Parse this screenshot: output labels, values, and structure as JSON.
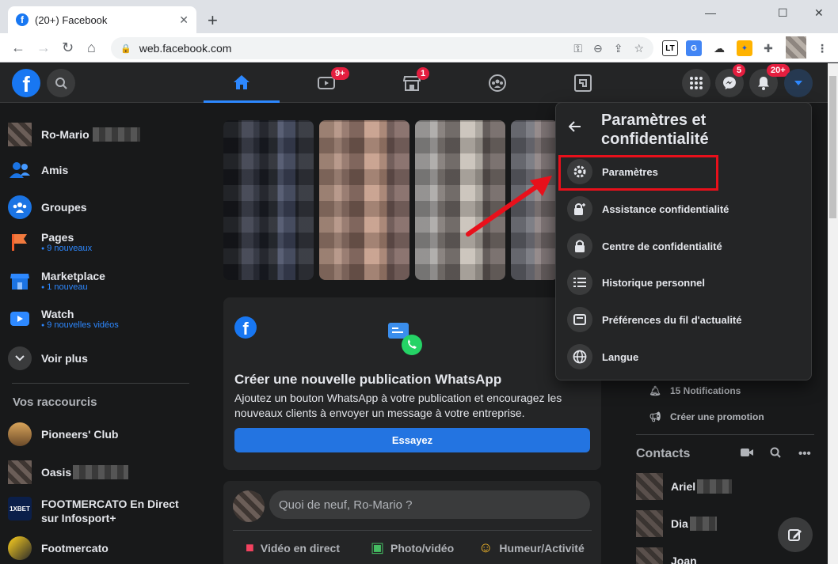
{
  "browser": {
    "tab_title": "(20+) Facebook",
    "tab_close": "✕",
    "new_tab": "+",
    "url": "web.facebook.com",
    "window_controls": [
      "—",
      "☐",
      "✕"
    ]
  },
  "header": {
    "badges": {
      "watch": "9+",
      "marketplace": "1",
      "messenger": "5",
      "notifications": "20+"
    }
  },
  "sidebar": {
    "user": "Ro-Mario",
    "items": [
      {
        "label": "Amis"
      },
      {
        "label": "Groupes"
      },
      {
        "label": "Pages",
        "sub": "9 nouveaux"
      },
      {
        "label": "Marketplace",
        "sub": "1 nouveau"
      },
      {
        "label": "Watch",
        "sub": "9 nouvelles vidéos"
      },
      {
        "label": "Voir plus"
      }
    ],
    "shortcuts_title": "Vos raccourcis",
    "shortcuts": [
      {
        "label": "Pioneers' Club"
      },
      {
        "label": "Oasis"
      },
      {
        "label": "FOOTMERCATO En Direct sur Infosport+"
      },
      {
        "label": "Footmercato"
      }
    ]
  },
  "whatsapp_card": {
    "title": "Créer une nouvelle publication WhatsApp",
    "body": "Ajoutez un bouton WhatsApp à votre publication et encouragez les nouveaux clients à envoyer un message à votre entreprise.",
    "button": "Essayez"
  },
  "composer": {
    "placeholder": "Quoi de neuf, Ro-Mario ?",
    "actions": [
      "Vidéo en direct",
      "Photo/vidéo",
      "Humeur/Activité"
    ]
  },
  "right_column": {
    "notifications": "15 Notifications",
    "promotion": "Créer une promotion",
    "contacts_title": "Contacts",
    "contacts": [
      "Ariel",
      "Dia",
      "Joan"
    ]
  },
  "dropdown": {
    "title": "Paramètres et confidentialité",
    "items": [
      {
        "label": "Paramètres",
        "icon": "gear-icon"
      },
      {
        "label": "Assistance confidentialité",
        "icon": "lock-plus-icon"
      },
      {
        "label": "Centre de confidentialité",
        "icon": "lock-icon"
      },
      {
        "label": "Historique personnel",
        "icon": "list-icon"
      },
      {
        "label": "Préférences du fil d'actualité",
        "icon": "feed-icon"
      },
      {
        "label": "Langue",
        "icon": "globe-icon"
      }
    ]
  },
  "colors": {
    "brand": "#1877f2",
    "annotation": "#e8101b"
  }
}
